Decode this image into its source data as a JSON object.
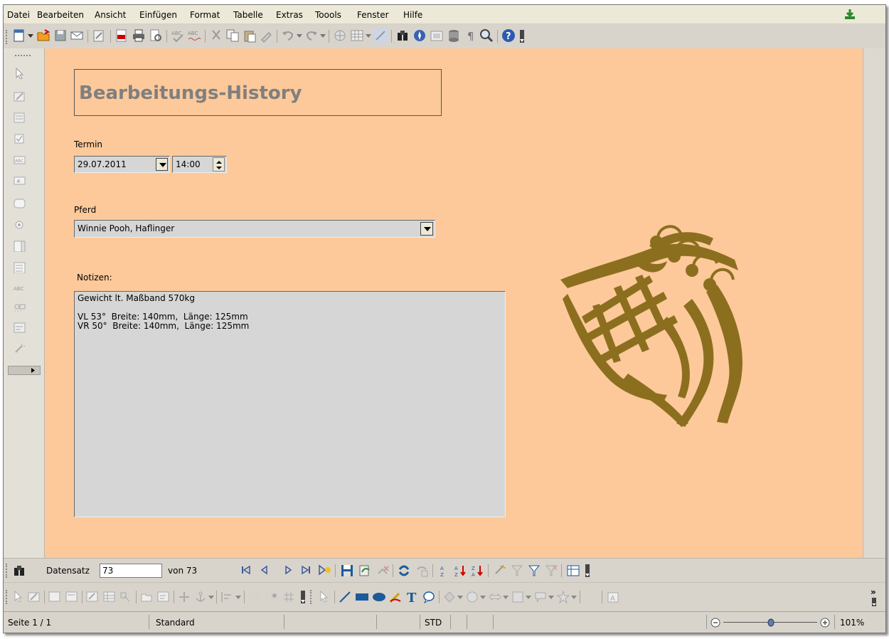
{
  "menu": [
    "Datei",
    "Bearbeiten",
    "Ansicht",
    "Einfügen",
    "Format",
    "Tabelle",
    "Extras",
    "Toools",
    "Fenster",
    "Hilfe"
  ],
  "form": {
    "title": "Bearbeitungs-History",
    "termin_label": "Termin",
    "date_value": "29.07.2011",
    "time_value": "14:00",
    "pferd_label": "Pferd",
    "pferd_value": "Winnie Pooh, Haflinger",
    "notizen_label": "Notizen:",
    "notizen_value": "Gewicht lt. Maßband 570kg\n\nVL 53°  Breite: 140mm,  Länge: 125mm\nVR 50°  Breite: 140mm,  Länge: 125mm"
  },
  "navigation": {
    "datensatz_label": "Datensatz",
    "record_value": "73",
    "von_label": "von 73"
  },
  "status": {
    "page": "Seite 1 / 1",
    "style": "Standard",
    "mode": "STD",
    "zoom": "101%"
  },
  "colors": {
    "document_bg": "#fdc99a",
    "logo": "#8b6f1f",
    "title_text": "#7f7f7f"
  },
  "icons": [
    "new-document-icon",
    "open-folder-icon",
    "save-icon",
    "email-icon",
    "edit-file-icon",
    "export-pdf-icon",
    "print-icon",
    "page-preview-icon",
    "spellcheck-icon",
    "autospell-icon",
    "cut-icon",
    "copy-icon",
    "paste-icon",
    "clone-format-icon",
    "undo-icon",
    "redo-icon",
    "hyperlink-icon",
    "table-icon",
    "show-draw-icon",
    "find-icon",
    "navigator-icon",
    "gallery-icon",
    "data-sources-icon",
    "formatting-marks-icon",
    "zoom-icon",
    "help-icon"
  ]
}
